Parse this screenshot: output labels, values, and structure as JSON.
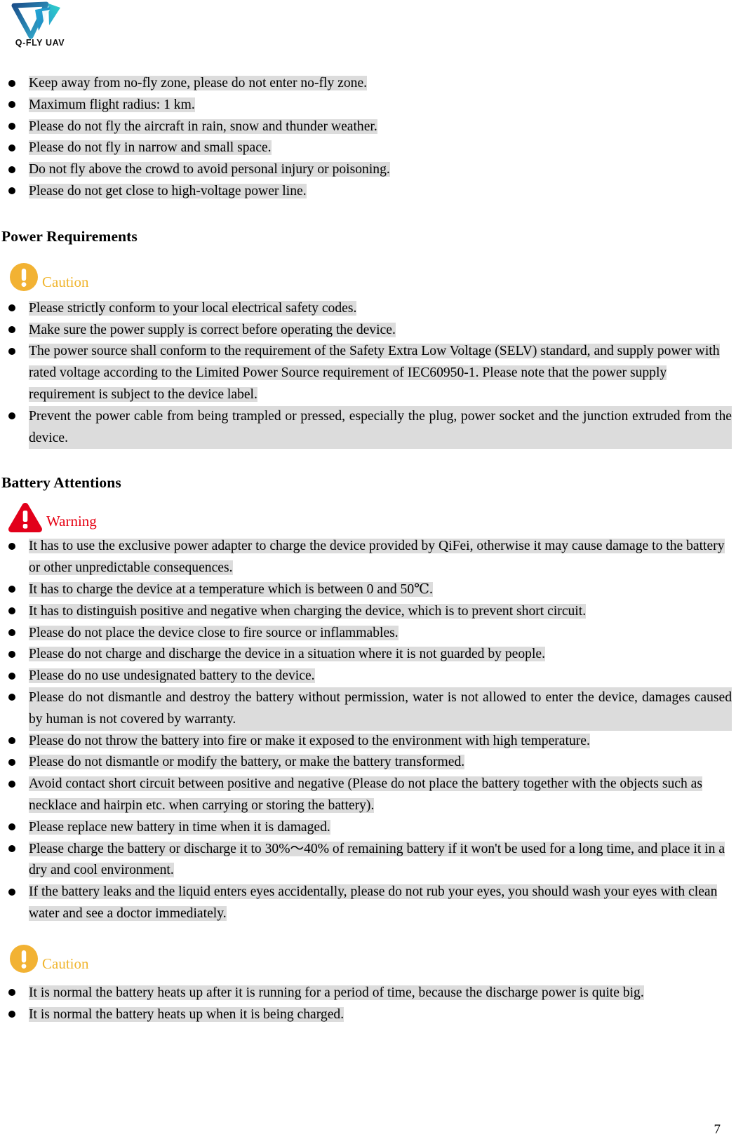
{
  "logo": {
    "name": "q-fly-uav-logo",
    "wordmark": "Q-FLY UAV"
  },
  "flight_safety": {
    "bullets": [
      "Keep away from no-fly zone, please do not enter no-fly zone.",
      "Maximum flight radius: 1 km.",
      "Please do not fly the aircraft in rain, snow and thunder weather.",
      "Please do not fly in narrow and small space.",
      "Do not fly above the crowd to avoid personal injury or poisoning.",
      "Please do not get close to high-voltage power line."
    ]
  },
  "power_requirements": {
    "heading": "Power Requirements",
    "admonition": {
      "icon": "caution-circle-icon",
      "label": "Caution",
      "color": "#f0b52e"
    },
    "bullets": [
      "Please strictly conform to your local electrical safety codes.",
      "Make sure the power supply is correct before operating the device.",
      "The power source shall conform to the requirement of the Safety Extra Low Voltage (SELV) standard, and supply power with rated voltage according to the Limited Power Source requirement of IEC60950-1. Please note that the power supply requirement is subject to the device label.",
      "Prevent the power cable from being trampled or pressed, especially the plug, power socket and the junction extruded from the device."
    ]
  },
  "battery_attentions": {
    "heading": "Battery Attentions",
    "warning": {
      "icon": "warning-triangle-icon",
      "label": "Warning",
      "color": "#e60012"
    },
    "warning_bullets": [
      "It has to use the exclusive power adapter to charge the device provided by QiFei, otherwise it may cause damage to the battery or other unpredictable consequences.",
      "It has to charge the device at a temperature which is between 0 and 50℃.",
      "It has to distinguish positive and negative when charging the device, which is to prevent short circuit.",
      "Please do not place the device close to fire source or inflammables.",
      "Please do not charge and discharge the device in a situation where it is not guarded by people.",
      "Please do no use undesignated battery to the device.",
      "Please do not dismantle and destroy the battery without permission, water is not allowed to enter the device, damages caused by human is not covered by warranty.",
      "Please do not throw the battery into fire or make it exposed to the environment with high temperature.",
      "Please do not dismantle or modify the battery, or make the battery transformed.",
      "Avoid contact short circuit between positive and negative (Please do not place the battery together with the objects such as necklace and hairpin etc. when carrying or storing the battery).",
      "Please replace new battery in time when it is damaged.",
      "Please charge the battery or discharge it to 30%～40% of remaining battery if it won't be used for a long time, and place it in a dry and cool environment.",
      "If the battery leaks and the liquid enters eyes accidentally, please do not rub your eyes, you should wash your eyes with clean water and see a doctor immediately."
    ],
    "caution": {
      "icon": "caution-circle-icon",
      "label": "Caution",
      "color": "#f0b52e"
    },
    "caution_bullets": [
      "It is normal the battery heats up after it is running for a period of time, because the discharge power is quite big.",
      "It is normal the battery heats up when it is being charged."
    ]
  },
  "footer": {
    "page_number": "7"
  },
  "styling": {
    "highlight_color": "#dcdcdc",
    "caution_color": "#f0b52e",
    "warning_color": "#e60012",
    "logo_gradient_from": "#1b4f8a",
    "logo_gradient_to": "#35c6d8"
  }
}
